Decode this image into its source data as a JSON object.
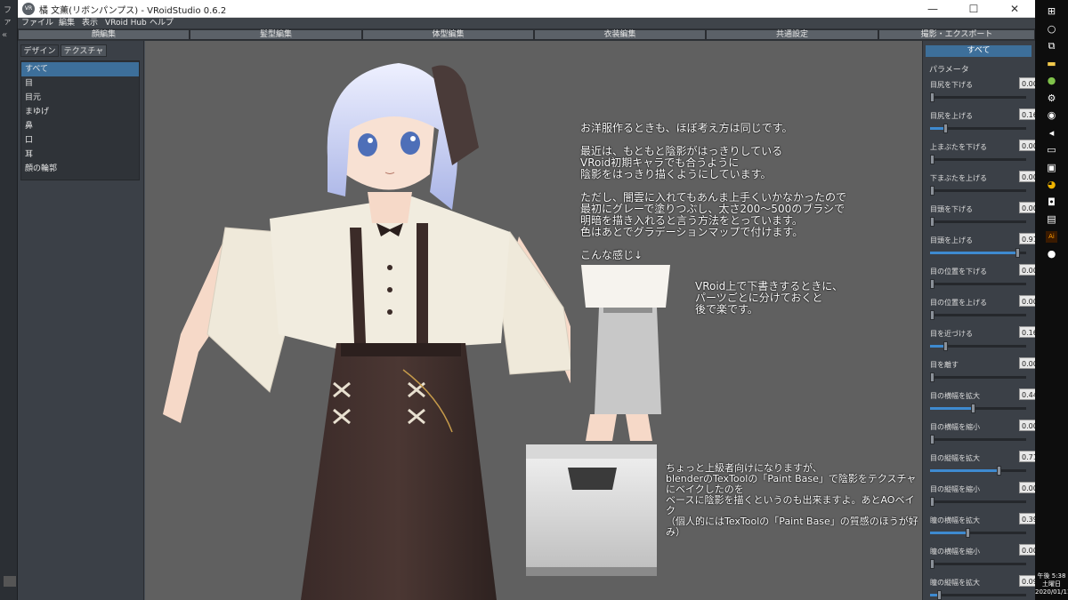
{
  "window": {
    "title": "橘 文薫(リボンパンプス) - VRoidStudio 0.6.2",
    "minimize_glyph": "—",
    "maximize_glyph": "☐",
    "close_glyph": "✕"
  },
  "left_strip": {
    "text1": "ファ",
    "text2": "«"
  },
  "menu": [
    "ファイル",
    "編集",
    "表示",
    "VRoid Hub",
    "ヘルプ"
  ],
  "main_tabs": [
    "顔編集",
    "髪型編集",
    "体型編集",
    "衣装編集",
    "共通設定",
    "撮影・エクスポート"
  ],
  "left_panel": {
    "sub_tabs": [
      "デザイン",
      "テクスチャ"
    ],
    "categories": [
      "すべて",
      "目",
      "目元",
      "まゆげ",
      "鼻",
      "口",
      "耳",
      "顔の輪郭"
    ]
  },
  "captions": {
    "block1": "お洋服作るときも、ほぼ考え方は同じです。\n\n最近は、もともと陰影がはっきりしている\nVRoid初期キャラでも合うように\n陰影をはっきり描くようにしています。\n\nただし、闇雲に入れてもあんま上手くいかなかったので\n最初にグレーで塗りつぶし、太さ200～500のブラシで\n明暗を描き入れると言う方法をとっています。\n色はあとでグラデーションマップで付けます。\n\nこんな感じ↓",
    "block2": "VRoid上で下書きするときに、\nパーツごとに分けておくと\n後で楽です。",
    "block3": "ちょっと上級者向けになりますが、\nblenderのTexToolの「Paint Base」で陰影をテクスチャにベイクしたのを\nベースに陰影を描くというのも出来ますよ。あとAOベイク\n（個人的にはTexToolの「Paint Base」の質感のほうが好み）"
  },
  "right_panel": {
    "tab": "すべて",
    "title": "パラメータ",
    "params": [
      {
        "label": "目尻を下げる",
        "value": "0.00",
        "fraction": 0.0
      },
      {
        "label": "目尻を上げる",
        "value": "0.16",
        "fraction": 0.16
      },
      {
        "label": "上まぶたを下げる",
        "value": "0.00",
        "fraction": 0.0
      },
      {
        "label": "下まぶたを上げる",
        "value": "0.00",
        "fraction": 0.0
      },
      {
        "label": "目頭を下げる",
        "value": "0.00",
        "fraction": 0.0
      },
      {
        "label": "目頭を上げる",
        "value": "0.91",
        "fraction": 0.91
      },
      {
        "label": "目の位置を下げる",
        "value": "0.00",
        "fraction": 0.0
      },
      {
        "label": "目の位置を上げる",
        "value": "0.00",
        "fraction": 0.0
      },
      {
        "label": "目を近づける",
        "value": "0.16",
        "fraction": 0.16
      },
      {
        "label": "目を離す",
        "value": "0.00",
        "fraction": 0.0
      },
      {
        "label": "目の横幅を拡大",
        "value": "0.44",
        "fraction": 0.44
      },
      {
        "label": "目の横幅を縮小",
        "value": "0.00",
        "fraction": 0.0
      },
      {
        "label": "目の縦幅を拡大",
        "value": "0.71",
        "fraction": 0.71
      },
      {
        "label": "目の縦幅を縮小",
        "value": "0.00",
        "fraction": 0.0
      },
      {
        "label": "瞳の横幅を拡大",
        "value": "0.39",
        "fraction": 0.39
      },
      {
        "label": "瞳の横幅を縮小",
        "value": "0.00",
        "fraction": 0.0
      },
      {
        "label": "瞳の縦幅を拡大",
        "value": "0.09",
        "fraction": 0.09
      }
    ]
  },
  "taskbar": {
    "icons": [
      "windows-icon",
      "cortana-icon",
      "task-view-icon",
      "folder-icon",
      "app-green-icon",
      "settings-icon",
      "steam-icon",
      "volume-icon",
      "network-icon",
      "app-dark-icon",
      "chrome-icon",
      "app-chat-icon",
      "app-blue-icon",
      "illustrator-icon",
      "vroid-icon"
    ],
    "glyphs": [
      "⊞",
      "○",
      "⧉",
      "▬",
      "●",
      "⚙",
      "◉",
      "◂",
      "▭",
      "▣",
      "◕",
      "◘",
      "▤",
      "Ai",
      "●"
    ],
    "clock_time": "午後 5:38",
    "clock_day": "土曜日",
    "clock_date": "2020/01/11"
  },
  "colors": {
    "accent": "#3d6f9a",
    "slider": "#3e8ad0",
    "viewport": "#606060"
  }
}
